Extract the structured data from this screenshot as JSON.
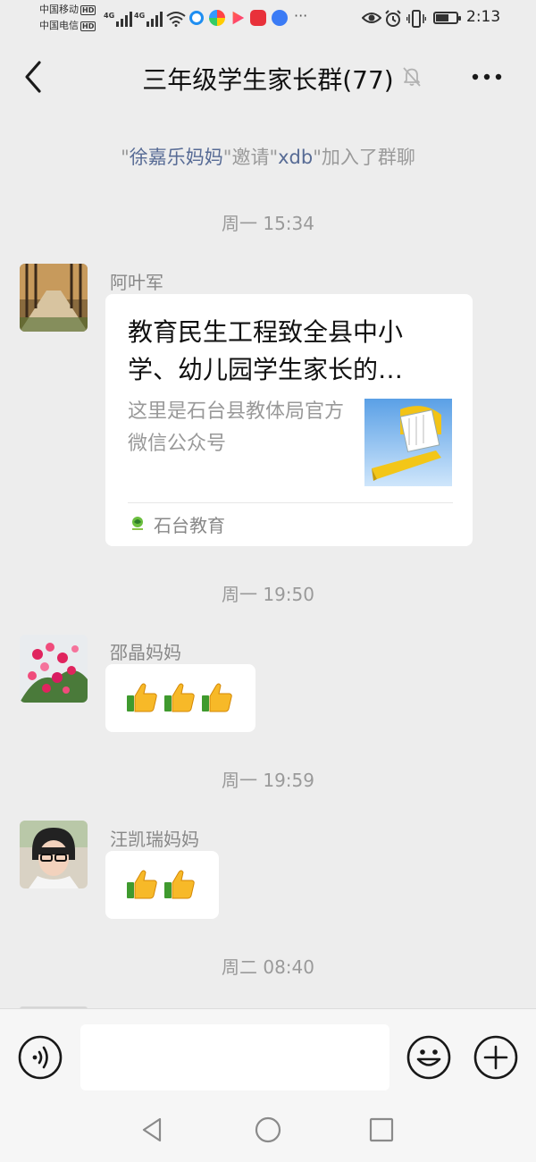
{
  "status_bar": {
    "carrier1": "中国移动",
    "carrier2": "中国电信",
    "hd": "HD",
    "net1": "4G",
    "net2": "4G",
    "more": "···",
    "time": "2:13",
    "battery_level": 0.6
  },
  "header": {
    "title": "三年级学生家长群(77)"
  },
  "chat": {
    "system_notice": {
      "inviter": "徐嘉乐妈妈",
      "invite_verb": "邀请",
      "invitee": "xdb",
      "suffix": "加入了群聊",
      "quote_open": "\"",
      "quote_close": "\""
    },
    "timestamps": [
      "周一 15:34",
      "周一 19:50",
      "周一 19:59",
      "周二 08:40"
    ],
    "messages": [
      {
        "sender": "阿叶军",
        "type": "link_card",
        "card": {
          "title": "教育民生工程致全县中小学、幼儿园学生家长的…",
          "description": "这里是石台县教体局官方微信公众号",
          "source": "石台教育"
        }
      },
      {
        "sender": "邵晶妈妈",
        "type": "emoji",
        "emoji": "thumbs-up",
        "count": 3
      },
      {
        "sender": "汪凯瑞妈妈",
        "type": "emoji",
        "emoji": "thumbs-up",
        "count": 2
      }
    ]
  },
  "input_bar": {
    "placeholder": ""
  },
  "colors": {
    "background": "#ededed",
    "bubble": "#ffffff",
    "name_link": "#576b95",
    "muted_text": "#9a9a9a"
  },
  "icons": {
    "back": "chevron-left-icon",
    "mute": "bell-off-icon",
    "more": "more-dots-icon",
    "voice": "voice-icon",
    "emoji": "smiley-icon",
    "plus": "plus-circle-icon"
  }
}
